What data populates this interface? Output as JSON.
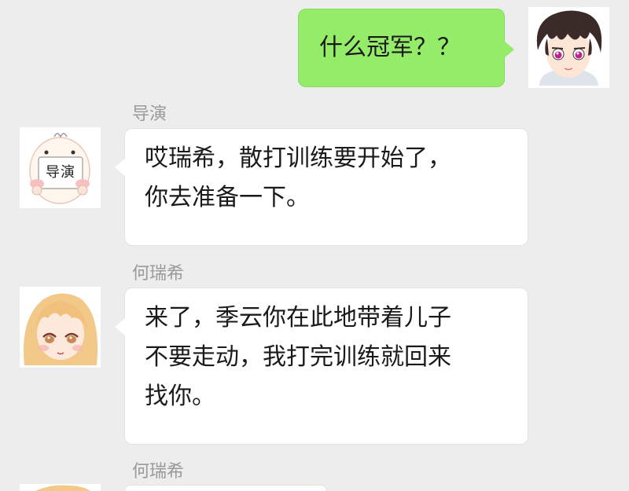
{
  "messages": [
    {
      "side": "out",
      "lines": [
        "什么冠军？？"
      ]
    },
    {
      "side": "in",
      "sender": "导演",
      "avatar_text": "导演",
      "lines": [
        "哎瑞希，散打训练要开始了，",
        "你去准备一下。"
      ]
    },
    {
      "side": "in",
      "sender": "何瑞希",
      "lines": [
        "来了，季云你在此地带着儿子",
        "不要走动，我打完训练就回来",
        "找你。"
      ]
    },
    {
      "side": "in",
      "sender": "何瑞希",
      "lines": []
    }
  ],
  "colors": {
    "background": "#ededed",
    "outgoing_bubble": "#95ec69",
    "incoming_bubble": "#ffffff",
    "sender_name": "#9a9a9a"
  },
  "icons": {
    "self_avatar": "dark-haired-boy-avatar-icon",
    "director_avatar": "director-sign-avatar-icon",
    "herui_avatar": "blonde-girl-avatar-icon"
  }
}
